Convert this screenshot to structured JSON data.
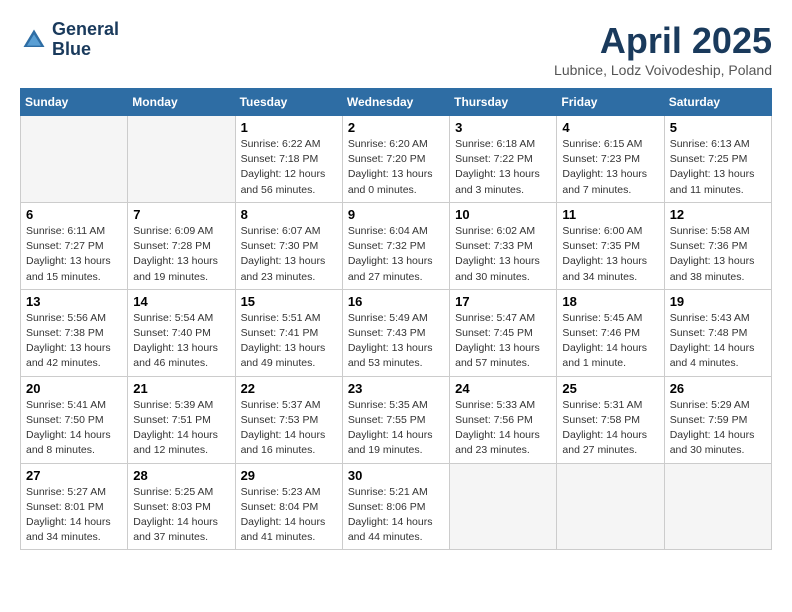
{
  "header": {
    "logo_line1": "General",
    "logo_line2": "Blue",
    "month_title": "April 2025",
    "location": "Lubnice, Lodz Voivodeship, Poland"
  },
  "weekdays": [
    "Sunday",
    "Monday",
    "Tuesday",
    "Wednesday",
    "Thursday",
    "Friday",
    "Saturday"
  ],
  "weeks": [
    [
      {
        "day": "",
        "sunrise": "",
        "sunset": "",
        "daylight": ""
      },
      {
        "day": "",
        "sunrise": "",
        "sunset": "",
        "daylight": ""
      },
      {
        "day": "1",
        "sunrise": "Sunrise: 6:22 AM",
        "sunset": "Sunset: 7:18 PM",
        "daylight": "Daylight: 12 hours and 56 minutes."
      },
      {
        "day": "2",
        "sunrise": "Sunrise: 6:20 AM",
        "sunset": "Sunset: 7:20 PM",
        "daylight": "Daylight: 13 hours and 0 minutes."
      },
      {
        "day": "3",
        "sunrise": "Sunrise: 6:18 AM",
        "sunset": "Sunset: 7:22 PM",
        "daylight": "Daylight: 13 hours and 3 minutes."
      },
      {
        "day": "4",
        "sunrise": "Sunrise: 6:15 AM",
        "sunset": "Sunset: 7:23 PM",
        "daylight": "Daylight: 13 hours and 7 minutes."
      },
      {
        "day": "5",
        "sunrise": "Sunrise: 6:13 AM",
        "sunset": "Sunset: 7:25 PM",
        "daylight": "Daylight: 13 hours and 11 minutes."
      }
    ],
    [
      {
        "day": "6",
        "sunrise": "Sunrise: 6:11 AM",
        "sunset": "Sunset: 7:27 PM",
        "daylight": "Daylight: 13 hours and 15 minutes."
      },
      {
        "day": "7",
        "sunrise": "Sunrise: 6:09 AM",
        "sunset": "Sunset: 7:28 PM",
        "daylight": "Daylight: 13 hours and 19 minutes."
      },
      {
        "day": "8",
        "sunrise": "Sunrise: 6:07 AM",
        "sunset": "Sunset: 7:30 PM",
        "daylight": "Daylight: 13 hours and 23 minutes."
      },
      {
        "day": "9",
        "sunrise": "Sunrise: 6:04 AM",
        "sunset": "Sunset: 7:32 PM",
        "daylight": "Daylight: 13 hours and 27 minutes."
      },
      {
        "day": "10",
        "sunrise": "Sunrise: 6:02 AM",
        "sunset": "Sunset: 7:33 PM",
        "daylight": "Daylight: 13 hours and 30 minutes."
      },
      {
        "day": "11",
        "sunrise": "Sunrise: 6:00 AM",
        "sunset": "Sunset: 7:35 PM",
        "daylight": "Daylight: 13 hours and 34 minutes."
      },
      {
        "day": "12",
        "sunrise": "Sunrise: 5:58 AM",
        "sunset": "Sunset: 7:36 PM",
        "daylight": "Daylight: 13 hours and 38 minutes."
      }
    ],
    [
      {
        "day": "13",
        "sunrise": "Sunrise: 5:56 AM",
        "sunset": "Sunset: 7:38 PM",
        "daylight": "Daylight: 13 hours and 42 minutes."
      },
      {
        "day": "14",
        "sunrise": "Sunrise: 5:54 AM",
        "sunset": "Sunset: 7:40 PM",
        "daylight": "Daylight: 13 hours and 46 minutes."
      },
      {
        "day": "15",
        "sunrise": "Sunrise: 5:51 AM",
        "sunset": "Sunset: 7:41 PM",
        "daylight": "Daylight: 13 hours and 49 minutes."
      },
      {
        "day": "16",
        "sunrise": "Sunrise: 5:49 AM",
        "sunset": "Sunset: 7:43 PM",
        "daylight": "Daylight: 13 hours and 53 minutes."
      },
      {
        "day": "17",
        "sunrise": "Sunrise: 5:47 AM",
        "sunset": "Sunset: 7:45 PM",
        "daylight": "Daylight: 13 hours and 57 minutes."
      },
      {
        "day": "18",
        "sunrise": "Sunrise: 5:45 AM",
        "sunset": "Sunset: 7:46 PM",
        "daylight": "Daylight: 14 hours and 1 minute."
      },
      {
        "day": "19",
        "sunrise": "Sunrise: 5:43 AM",
        "sunset": "Sunset: 7:48 PM",
        "daylight": "Daylight: 14 hours and 4 minutes."
      }
    ],
    [
      {
        "day": "20",
        "sunrise": "Sunrise: 5:41 AM",
        "sunset": "Sunset: 7:50 PM",
        "daylight": "Daylight: 14 hours and 8 minutes."
      },
      {
        "day": "21",
        "sunrise": "Sunrise: 5:39 AM",
        "sunset": "Sunset: 7:51 PM",
        "daylight": "Daylight: 14 hours and 12 minutes."
      },
      {
        "day": "22",
        "sunrise": "Sunrise: 5:37 AM",
        "sunset": "Sunset: 7:53 PM",
        "daylight": "Daylight: 14 hours and 16 minutes."
      },
      {
        "day": "23",
        "sunrise": "Sunrise: 5:35 AM",
        "sunset": "Sunset: 7:55 PM",
        "daylight": "Daylight: 14 hours and 19 minutes."
      },
      {
        "day": "24",
        "sunrise": "Sunrise: 5:33 AM",
        "sunset": "Sunset: 7:56 PM",
        "daylight": "Daylight: 14 hours and 23 minutes."
      },
      {
        "day": "25",
        "sunrise": "Sunrise: 5:31 AM",
        "sunset": "Sunset: 7:58 PM",
        "daylight": "Daylight: 14 hours and 27 minutes."
      },
      {
        "day": "26",
        "sunrise": "Sunrise: 5:29 AM",
        "sunset": "Sunset: 7:59 PM",
        "daylight": "Daylight: 14 hours and 30 minutes."
      }
    ],
    [
      {
        "day": "27",
        "sunrise": "Sunrise: 5:27 AM",
        "sunset": "Sunset: 8:01 PM",
        "daylight": "Daylight: 14 hours and 34 minutes."
      },
      {
        "day": "28",
        "sunrise": "Sunrise: 5:25 AM",
        "sunset": "Sunset: 8:03 PM",
        "daylight": "Daylight: 14 hours and 37 minutes."
      },
      {
        "day": "29",
        "sunrise": "Sunrise: 5:23 AM",
        "sunset": "Sunset: 8:04 PM",
        "daylight": "Daylight: 14 hours and 41 minutes."
      },
      {
        "day": "30",
        "sunrise": "Sunrise: 5:21 AM",
        "sunset": "Sunset: 8:06 PM",
        "daylight": "Daylight: 14 hours and 44 minutes."
      },
      {
        "day": "",
        "sunrise": "",
        "sunset": "",
        "daylight": ""
      },
      {
        "day": "",
        "sunrise": "",
        "sunset": "",
        "daylight": ""
      },
      {
        "day": "",
        "sunrise": "",
        "sunset": "",
        "daylight": ""
      }
    ]
  ]
}
